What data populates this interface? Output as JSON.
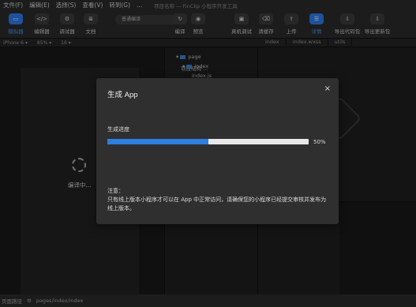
{
  "menu": [
    "文件(F)",
    "编辑(E)",
    "选择(S)",
    "查看(V)",
    "转到(G)",
    "..."
  ],
  "window_title": "项目名称 — FinClip 小程序开发工具",
  "toolbar": {
    "left_buttons": [
      {
        "label": "模拟器",
        "icon": "phone-icon",
        "glyph": "▭",
        "active": true
      },
      {
        "label": "编辑器",
        "icon": "code-icon",
        "glyph": "</>",
        "active": false
      },
      {
        "label": "调试器",
        "icon": "debug-icon",
        "glyph": "⚙",
        "active": false
      },
      {
        "label": "文档",
        "icon": "doc-icon",
        "glyph": "≣",
        "active": false
      }
    ],
    "compile_mode": "普通编译",
    "compile_buttons": [
      {
        "label": "编译",
        "icon": "refresh-icon",
        "glyph": "↻"
      },
      {
        "label": "预览",
        "icon": "eye-icon",
        "glyph": "◉"
      }
    ],
    "right_buttons": [
      {
        "label": "真机调试",
        "icon": "device-icon",
        "glyph": "▣",
        "active": false
      },
      {
        "label": "清缓存",
        "icon": "trash-icon",
        "glyph": "⌫",
        "active": false
      },
      {
        "label": "上传",
        "icon": "upload-icon",
        "glyph": "⇪",
        "active": false
      },
      {
        "label": "详情",
        "icon": "details-icon",
        "glyph": "☰",
        "active": true
      },
      {
        "label": "导出代码包",
        "icon": "export-icon",
        "glyph": "⇩",
        "active": false
      },
      {
        "label": "导出更新包",
        "icon": "export-update-icon",
        "glyph": "⇩",
        "active": false
      }
    ]
  },
  "subbar": [
    "iPhone 6 ▾",
    "85% ▾",
    "16 ▾"
  ],
  "tree": {
    "header": "项目结构·...",
    "items": [
      "page",
      "index",
      "index.js"
    ]
  },
  "editor_tabs": [
    "index",
    "index.wxss",
    "utils"
  ],
  "simulator": {
    "loading_text": "编译中..."
  },
  "statusbar": {
    "path_label": "页面路径",
    "path": "pages/index/index"
  },
  "dialog": {
    "title": "生成 App",
    "close_label": "×",
    "progress_label": "生成进度",
    "progress_percent": 50,
    "progress_text": "50%",
    "note_title": "注意：",
    "note_body": "只有线上版本小程序才可以在 App 中正常访问，请确保您的小程序已经提交审核并发布为线上版本。"
  },
  "colors": {
    "accent": "#2d7fe0",
    "dialog_bg": "#2f2f2f",
    "app_bg": "#1c1c1c"
  }
}
